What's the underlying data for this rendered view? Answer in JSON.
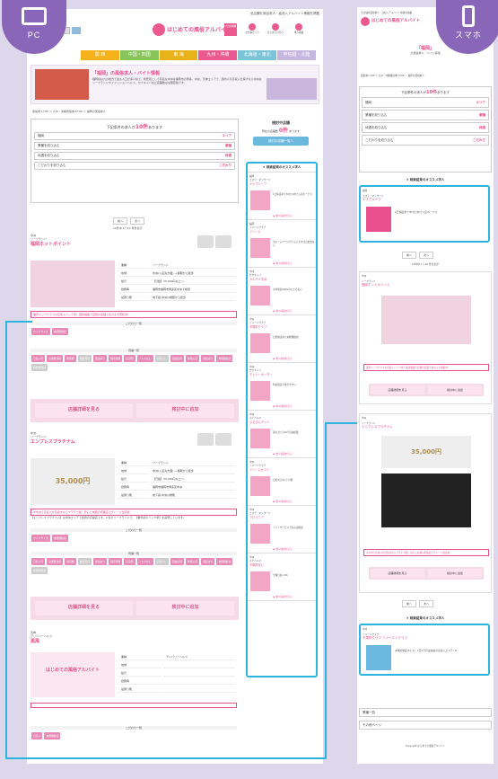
{
  "labels": {
    "pc": "PC",
    "sp": "スマホ"
  },
  "site": {
    "name": "はじめての風俗アルバイト",
    "region_badge": "九州沖縄",
    "top_line": "全店舗を風俗求人・高収入アルバイト情報を掲載",
    "header_icons": [
      "お仕事ガイド",
      "はじめての方へ",
      "求人掲載"
    ],
    "nav": [
      "関 西",
      "中国・四国",
      "東 海",
      "九州・沖縄",
      "北海道・東北",
      "甲信越・北陸"
    ],
    "nav_colors": [
      "#f5b21b",
      "#87c55a",
      "#e8b21a",
      "#ea5a8f",
      "#7ac4d8",
      "#c7b7e0"
    ]
  },
  "hero": {
    "title": "「福岡」の風俗求人・バイト情報",
    "text": "福岡県は九州地方で最も人口が多い県で、繁華街として有名な中洲は福岡市の博多、中央、天神エリアで、国内人気高収入を探すなら中洲はソープランドやファッションヘルス、セクキャバなど店舗数は全国屈指です。"
  },
  "breadcrumb": "風俗求人TOP ＞ 九州・沖縄風俗求人TOP ＞ 福岡の風俗求人",
  "search": {
    "summary_pre": "下記条件の求人が",
    "count": "10件",
    "summary_post": "あります",
    "rows": [
      {
        "label": "福岡",
        "action": "エリア"
      },
      {
        "label": "業種を絞り込む",
        "action": "業種"
      },
      {
        "label": "待遇を絞り込む",
        "action": "待遇"
      },
      {
        "label": "こだわりを絞り込む",
        "action": "こだわり"
      }
    ],
    "pager": [
      "前へ",
      "次へ"
    ],
    "pager_info": "10件中 1～10 件を表示"
  },
  "considering": {
    "title": "検討中店舗",
    "count_label": "現在の店舗数",
    "count": "0件",
    "suffix": "あります",
    "button": "検討中店舗一覧へ"
  },
  "recommend": {
    "title": "★ 検索結果のオススメ求人",
    "cards": [
      {
        "area": "福岡",
        "type": "エステ・マッサージ",
        "name": "ナナグループ",
        "text": "1日保証あり30分以内で入店ボーナス"
      },
      {
        "area": "福岡",
        "type": "イメージクラブ",
        "name": "ドリーム",
        "text": "当ホームページ見てもらえれば日給支払い"
      },
      {
        "area": "中洲",
        "type": "セクキャバ",
        "name": "カルチャ中洲",
        "text": "平均時給4000円以上で安心"
      },
      {
        "area": "中洲",
        "type": "イメージクラブ",
        "name": "不規則クラブ",
        "text": "日給保証あり未経験歓迎"
      },
      {
        "area": "中洲",
        "type": "セクキャバ",
        "name": "チェリーボーダー",
        "text": "時給保証で稼ぎやすい"
      },
      {
        "area": "中洲",
        "type": "ホテヘルス",
        "name": "ぷるるんギャル",
        "text": "週1日からOKで自由出勤"
      },
      {
        "area": "中洲",
        "type": "イメージクラブ",
        "name": "ドリームゼスト",
        "text": "日給3万円以上可能"
      },
      {
        "area": "中洲",
        "type": "エステ・マッサージ",
        "name": "アロマニア",
        "text": "ソフトサービスで初心者歓迎"
      },
      {
        "area": "中洲",
        "type": "ホテヘルス",
        "name": "不規則ぽい",
        "text": "全額日払いOK"
      }
    ],
    "detail_link": "▶ 求人情報を見る"
  },
  "listings": [
    {
      "area": "中洲",
      "type": "ソープランド",
      "name": "福岡ホットポイント",
      "rows": [
        [
          "業種",
          "ソープランド"
        ],
        [
          "地域",
          "中洲(入店先方面) → 各駅から徒歩"
        ],
        [
          "給与",
          "【日給】35,000円以上～"
        ],
        [
          "勤務時",
          "福岡市福岡市博多区中洲で検索"
        ],
        [
          "最寄り駅",
          "地下鉄 中洲川端駅から徒歩"
        ]
      ],
      "catch": "業界トップクラスの高収入バック率！雑誌掲載で話題の店舗で女の子大募集中！",
      "prefs_title": "こだわり一覧",
      "prefs": [
        "ワイドサイズ",
        "未経験歓迎"
      ],
      "benefits_title": "待遇一覧",
      "benefits": [
        "日払い可",
        "交通費支給",
        "寮完備",
        "衣装貸与",
        "送迎あり",
        "個室待機",
        "託児所",
        "ノルマなし",
        "罰金なし",
        "自由出勤",
        "体験入店",
        "保証あり",
        "未経験歓迎",
        "経験者優遇"
      ],
      "buttons": [
        "店舗詳細を見る",
        "検討中に追加"
      ]
    },
    {
      "area": "中洲",
      "type": "ソープランド",
      "name": "エンプレスプラチナム",
      "rows": [
        [
          "業種",
          "ソープランド"
        ],
        [
          "地域",
          "中洲(入店先方面) → 各駅から徒歩"
        ],
        [
          "給与",
          "【日給】35,000円以上～"
        ],
        [
          "勤務時",
          "福岡市福岡市博多区中洲"
        ],
        [
          "最寄り駅",
          "地下鉄 中洲川端駅"
        ]
      ],
      "banner": "35,000円",
      "catch": "★中洲で高収入を目指すならプラチナ級！安心と信頼の老舗店でグレード最高峰",
      "desc": "【エンプレスプラチナム】は中洲エリアで話題の高級店です。人気のソープランドで、【業界初のバック率】を実現しています。",
      "prefs_title": "こだわり一覧",
      "prefs": [
        "ワイドサイズ",
        "未経験歓迎"
      ],
      "benefits_title": "待遇一覧",
      "benefits": [
        "日払い可",
        "交通費支給",
        "寮完備",
        "衣装貸与",
        "送迎あり",
        "個室待機",
        "託児所",
        "ノルマなし",
        "罰金なし",
        "自由出勤",
        "体験入店",
        "保証あり",
        "未経験歓迎",
        "経験者優遇"
      ],
      "buttons": [
        "店舗詳細を見る",
        "検討中に追加"
      ]
    },
    {
      "area": "天神",
      "type": "デリバリーヘルス",
      "name": "風風",
      "rows": [
        [
          "業種",
          "デリバリーヘルス"
        ],
        [
          "地域",
          ""
        ],
        [
          "給与",
          ""
        ],
        [
          "勤務時",
          ""
        ],
        [
          "最寄り駅",
          ""
        ]
      ],
      "prefs_title": "こだわり一覧",
      "prefs": [
        "日払い",
        "未経験歓迎"
      ]
    }
  ],
  "sp": {
    "region": "「福岡」",
    "region_sub": "の風俗求人・バイト情報",
    "footer_links": [
      "業種一覧",
      "その他ページ"
    ],
    "copyright": "Copyright はじめての風俗アルバイト",
    "bottom_card": {
      "area": "中洲",
      "type": "イメージクラブ",
      "name": "不規則クラブ ファーストクラブ",
      "text": "★時給保証ボトル！1日5万円は余裕の高収入エステ♪★"
    },
    "sp_card_1": {
      "area": "中洲",
      "type": "ソープランド",
      "name": "福岡ホットポイント"
    },
    "sp_card_2": {
      "area": "中洲",
      "type": "ソープランド",
      "name": "エンプレスプラチナム"
    }
  }
}
